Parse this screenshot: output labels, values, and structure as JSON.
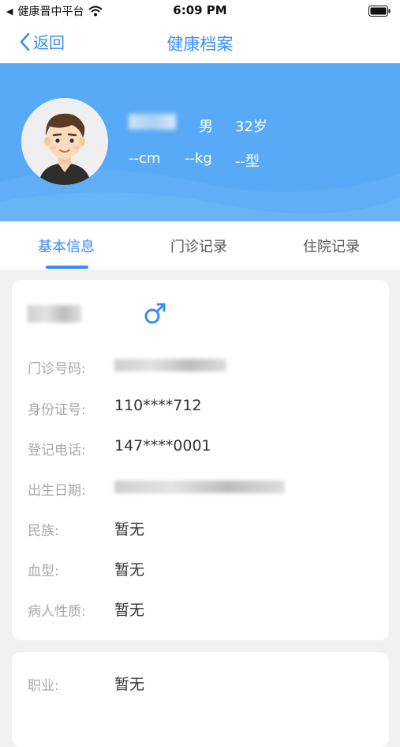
{
  "status_bar": {
    "carrier": "健康晋中平台",
    "time": "6:09 PM"
  },
  "nav": {
    "back_label": "返回",
    "title": "健康档案"
  },
  "profile": {
    "gender": "男",
    "age": "32岁",
    "height": "--cm",
    "weight": "--kg",
    "blood_type": "--型"
  },
  "tabs": [
    {
      "label": "基本信息",
      "active": true
    },
    {
      "label": "门诊记录",
      "active": false
    },
    {
      "label": "住院记录",
      "active": false
    }
  ],
  "basic_info": {
    "outpatient_no_label": "门诊号码:",
    "id_card_label": "身份证号:",
    "id_card_value": "110****712",
    "phone_label": "登记电话:",
    "phone_value": "147****0001",
    "birth_label": "出生日期:",
    "ethnicity_label": "民族:",
    "ethnicity_value": "暂无",
    "blood_label": "血型:",
    "blood_value": "暂无",
    "patient_type_label": "病人性质:",
    "patient_type_value": "暂无"
  },
  "extra_info": {
    "occupation_label": "职业:",
    "occupation_value": "暂无"
  },
  "colors": {
    "accent": "#3a8df0",
    "banner": "#58a9f6"
  },
  "icons": [
    "back-chevron-icon",
    "wifi-icon",
    "battery-icon",
    "male-gender-icon",
    "avatar"
  ]
}
